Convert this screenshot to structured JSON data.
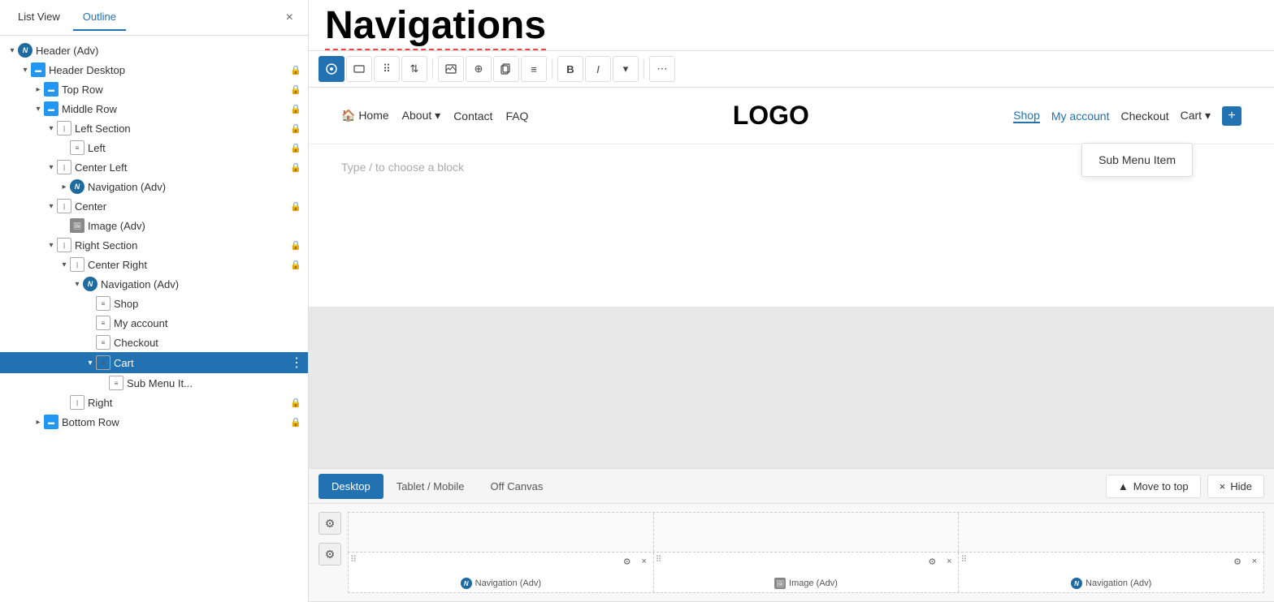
{
  "panel": {
    "tabs": [
      "List View",
      "Outline"
    ],
    "active_tab": "Outline",
    "close_label": "×"
  },
  "tree": {
    "items": [
      {
        "id": "header-adv",
        "label": "Header (Adv)",
        "indent": 0,
        "toggle": "▾",
        "icon_type": "nav",
        "has_lock": false,
        "selected": false
      },
      {
        "id": "header-desktop",
        "label": "Header Desktop",
        "indent": 1,
        "toggle": "▾",
        "icon_type": "row",
        "has_lock": true,
        "selected": false
      },
      {
        "id": "top-row",
        "label": "Top Row",
        "indent": 2,
        "toggle": "▸",
        "icon_type": "row",
        "has_lock": true,
        "selected": false
      },
      {
        "id": "middle-row",
        "label": "Middle Row",
        "indent": 2,
        "toggle": "▾",
        "icon_type": "row",
        "has_lock": true,
        "selected": false
      },
      {
        "id": "left-section",
        "label": "Left Section",
        "indent": 3,
        "toggle": "▾",
        "icon_type": "col",
        "has_lock": true,
        "selected": false
      },
      {
        "id": "left",
        "label": "Left",
        "indent": 4,
        "toggle": "",
        "icon_type": "menu",
        "has_lock": true,
        "selected": false
      },
      {
        "id": "center-left",
        "label": "Center Left",
        "indent": 3,
        "toggle": "▾",
        "icon_type": "col",
        "has_lock": true,
        "selected": false
      },
      {
        "id": "nav-adv-1",
        "label": "Navigation (Adv)",
        "indent": 4,
        "toggle": "▸",
        "icon_type": "nav",
        "has_lock": false,
        "selected": false
      },
      {
        "id": "center",
        "label": "Center",
        "indent": 3,
        "toggle": "▾",
        "icon_type": "col",
        "has_lock": true,
        "selected": false
      },
      {
        "id": "image-adv",
        "label": "Image (Adv)",
        "indent": 4,
        "toggle": "",
        "icon_type": "img",
        "has_lock": false,
        "selected": false
      },
      {
        "id": "right-section",
        "label": "Right Section",
        "indent": 3,
        "toggle": "▾",
        "icon_type": "col",
        "has_lock": true,
        "selected": false
      },
      {
        "id": "center-right",
        "label": "Center Right",
        "indent": 4,
        "toggle": "▾",
        "icon_type": "col",
        "has_lock": true,
        "selected": false
      },
      {
        "id": "nav-adv-2",
        "label": "Navigation (Adv)",
        "indent": 5,
        "toggle": "▾",
        "icon_type": "nav",
        "has_lock": false,
        "selected": false
      },
      {
        "id": "shop",
        "label": "Shop",
        "indent": 6,
        "toggle": "",
        "icon_type": "menu",
        "has_lock": false,
        "selected": false
      },
      {
        "id": "my-account",
        "label": "My account",
        "indent": 6,
        "toggle": "",
        "icon_type": "menu",
        "has_lock": false,
        "selected": false
      },
      {
        "id": "checkout",
        "label": "Checkout",
        "indent": 6,
        "toggle": "",
        "icon_type": "menu",
        "has_lock": false,
        "selected": false
      },
      {
        "id": "cart",
        "label": "Cart",
        "indent": 6,
        "toggle": "▾",
        "icon_type": "menu",
        "has_lock": false,
        "selected": true
      },
      {
        "id": "sub-menu-item",
        "label": "Sub Menu It...",
        "indent": 7,
        "toggle": "",
        "icon_type": "menu",
        "has_lock": false,
        "selected": false
      },
      {
        "id": "right",
        "label": "Right",
        "indent": 4,
        "toggle": "",
        "icon_type": "col",
        "has_lock": true,
        "selected": false
      },
      {
        "id": "bottom-row",
        "label": "Bottom Row",
        "indent": 2,
        "toggle": "▸",
        "icon_type": "row",
        "has_lock": true,
        "selected": false
      }
    ]
  },
  "page_title": "Navigations",
  "toolbar": {
    "buttons": [
      "compass",
      "resize",
      "grid",
      "up-down",
      "image",
      "plus-circle",
      "copy-block",
      "align",
      "bold",
      "italic",
      "chevron-down",
      "more"
    ]
  },
  "nav_preview": {
    "left_links": [
      "Home",
      "About ▾",
      "Contact",
      "FAQ"
    ],
    "logo": "LOGO",
    "right_links": [
      "Shop",
      "My account",
      "Checkout",
      "Cart ▾"
    ],
    "add_btn": "+",
    "sub_menu_label": "Sub Menu Item"
  },
  "type_block": "Type / to choose a block",
  "bottom_tabs": {
    "tabs": [
      "Desktop",
      "Tablet / Mobile",
      "Off Canvas"
    ],
    "active": "Desktop"
  },
  "move_to_top": "Move to top",
  "hide_label": "Hide",
  "sections": {
    "row2_cards": [
      {
        "label": "Navigation (Adv)",
        "icon_type": "nav"
      },
      {
        "label": "Image (Adv)",
        "icon_type": "img"
      },
      {
        "label": "Navigation (Adv)",
        "icon_type": "nav"
      }
    ]
  }
}
